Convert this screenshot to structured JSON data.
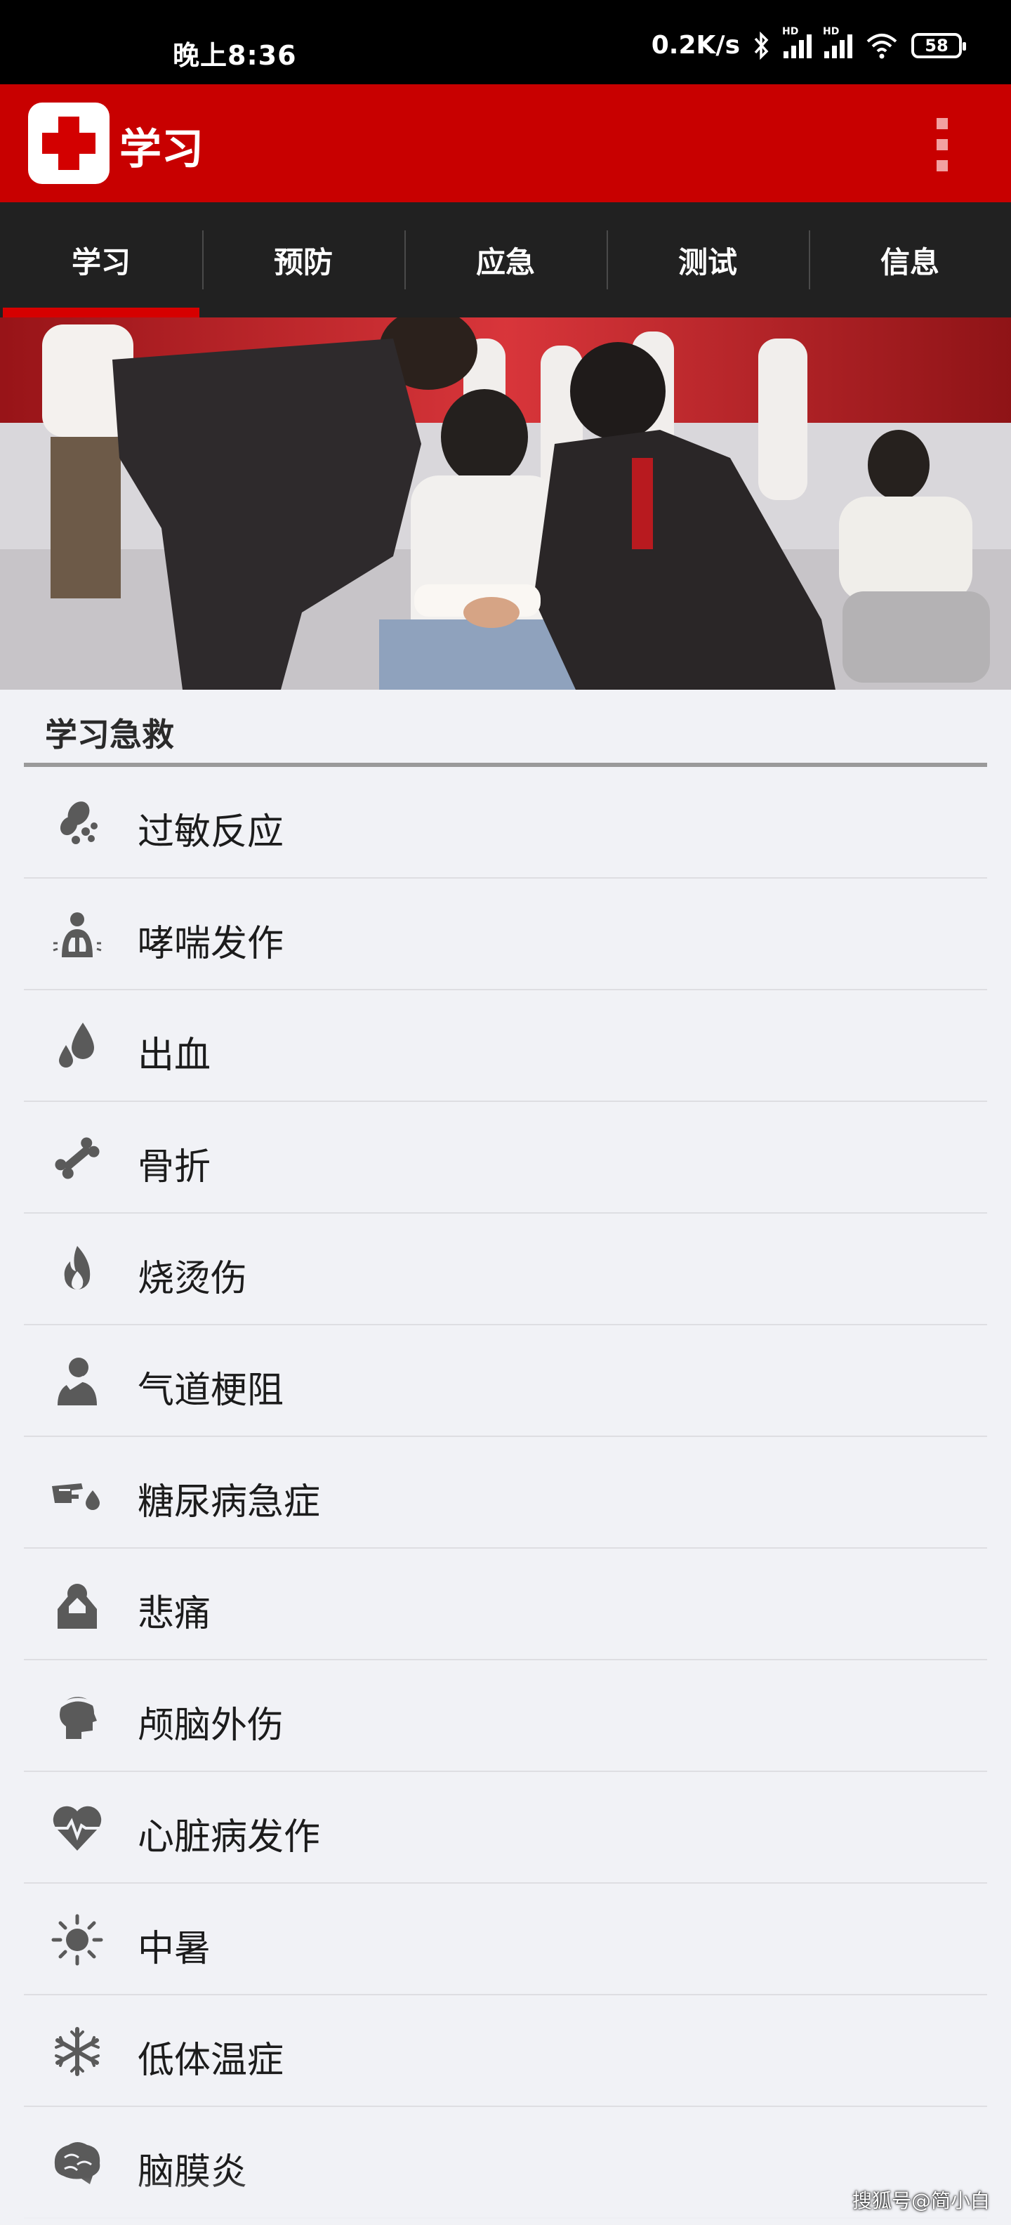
{
  "status_bar": {
    "time": "晚上8:36",
    "net_speed": "0.2K/s",
    "signal_label_1": "HD",
    "signal_label_2": "HD",
    "battery": "58"
  },
  "app_bar": {
    "title": "学习",
    "brand_color": "#c80000"
  },
  "tabs": [
    {
      "label": "学习",
      "active": true
    },
    {
      "label": "预防",
      "active": false
    },
    {
      "label": "应急",
      "active": false
    },
    {
      "label": "测试",
      "active": false
    },
    {
      "label": "信息",
      "active": false
    }
  ],
  "section": {
    "title": "学习急救"
  },
  "items": [
    {
      "label": "过敏反应",
      "icon": "allergy-peanut-icon"
    },
    {
      "label": "哮喘发作",
      "icon": "asthma-lungs-icon"
    },
    {
      "label": "出血",
      "icon": "bleeding-drops-icon"
    },
    {
      "label": "骨折",
      "icon": "bone-icon"
    },
    {
      "label": "烧烫伤",
      "icon": "flame-icon"
    },
    {
      "label": "气道梗阻",
      "icon": "choking-person-icon"
    },
    {
      "label": "糖尿病急症",
      "icon": "diabetes-finger-drop-icon"
    },
    {
      "label": "悲痛",
      "icon": "grief-person-icon"
    },
    {
      "label": "颅脑外伤",
      "icon": "head-injury-icon"
    },
    {
      "label": "心脏病发作",
      "icon": "heart-pulse-icon"
    },
    {
      "label": "中暑",
      "icon": "sun-icon"
    },
    {
      "label": "低体温症",
      "icon": "snowflake-icon"
    },
    {
      "label": "脑膜炎",
      "icon": "brain-icon"
    }
  ],
  "watermark": "搜狐号@简小白"
}
